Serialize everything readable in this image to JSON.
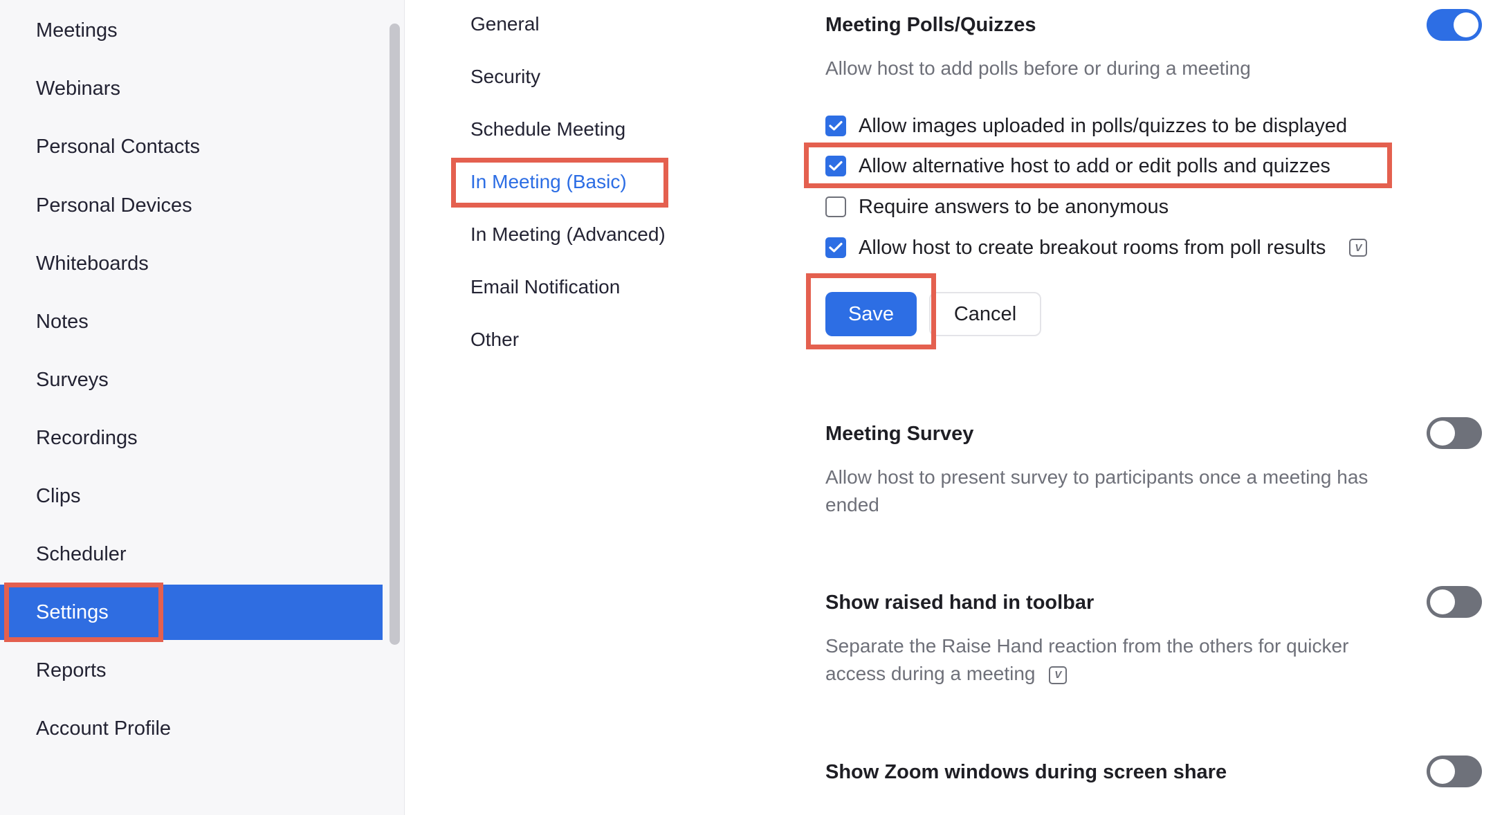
{
  "sidebar": {
    "items": [
      {
        "label": "Meetings"
      },
      {
        "label": "Webinars"
      },
      {
        "label": "Personal Contacts"
      },
      {
        "label": "Personal Devices"
      },
      {
        "label": "Whiteboards"
      },
      {
        "label": "Notes"
      },
      {
        "label": "Surveys"
      },
      {
        "label": "Recordings"
      },
      {
        "label": "Clips"
      },
      {
        "label": "Scheduler"
      },
      {
        "label": "Settings",
        "active": true
      },
      {
        "label": "Reports"
      },
      {
        "label": "Account Profile"
      }
    ]
  },
  "subnav": {
    "items": [
      {
        "label": "General"
      },
      {
        "label": "Security"
      },
      {
        "label": "Schedule Meeting"
      },
      {
        "label": "In Meeting (Basic)",
        "active": true
      },
      {
        "label": "In Meeting (Advanced)"
      },
      {
        "label": "Email Notification"
      },
      {
        "label": "Other"
      }
    ]
  },
  "polls": {
    "title": "Meeting Polls/Quizzes",
    "description": "Allow host to add polls before or during a meeting",
    "enabled": true,
    "options": [
      {
        "label": "Allow images uploaded in polls/quizzes to be displayed",
        "checked": true
      },
      {
        "label": "Allow alternative host to add or edit polls and quizzes",
        "checked": true
      },
      {
        "label": "Require answers to be anonymous",
        "checked": false
      },
      {
        "label": "Allow host to create breakout rooms from poll results",
        "checked": true,
        "info_icon": "version-icon"
      }
    ],
    "save_label": "Save",
    "cancel_label": "Cancel"
  },
  "survey": {
    "title": "Meeting Survey",
    "description": "Allow host to present survey to participants once a meeting has ended",
    "enabled": false
  },
  "raised_hand": {
    "title": "Show raised hand in toolbar",
    "description": "Separate the Raise Hand reaction from the others for quicker access during a meeting",
    "enabled": false,
    "info_icon": "version-icon"
  },
  "screen_share": {
    "title": "Show Zoom windows during screen share",
    "enabled": false
  },
  "colors": {
    "accent": "#2d6ee4",
    "highlight": "#e4604f",
    "sidebar_bg": "#f7f7f9",
    "toggle_off": "#6e717a"
  }
}
